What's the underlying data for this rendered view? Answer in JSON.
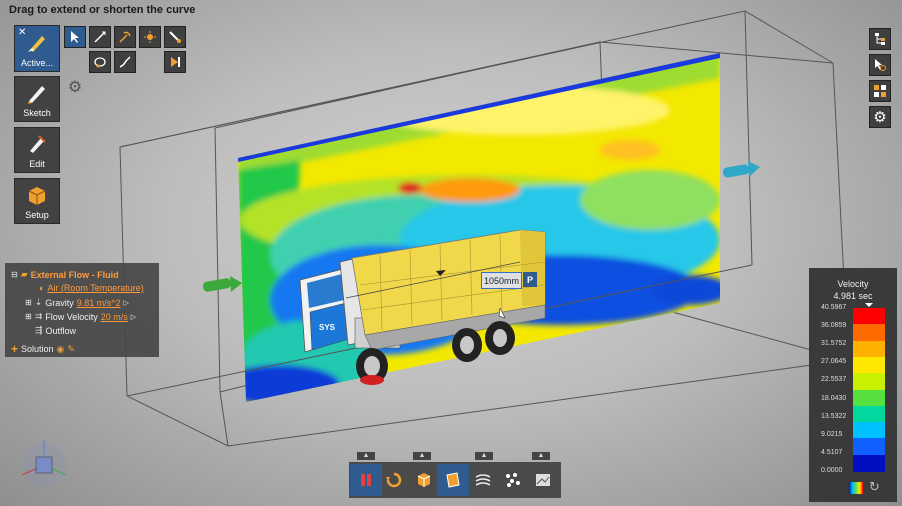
{
  "hint": "Drag to extend or shorten the curve",
  "toolbar": {
    "active_label": "Active...",
    "sketch_label": "Sketch",
    "edit_label": "Edit",
    "setup_label": "Setup"
  },
  "tree": {
    "root": "External Flow - Fluid",
    "fluid": "Air (Room Temperature)",
    "gravity_label": "Gravity",
    "gravity_value": "9.81 m/s^2",
    "flow_velocity_label": "Flow Velocity",
    "flow_velocity_value": "20 m/s",
    "outflow": "Outflow",
    "solution": "Solution"
  },
  "dimension": {
    "value": "1050mm",
    "tag": "P"
  },
  "truck_logo": "SYS",
  "legend": {
    "title": "Velocity",
    "time": "4.981 sec",
    "values": [
      "40.5967",
      "36.0859",
      "31.5752",
      "27.0645",
      "22.5537",
      "18.0430",
      "13.5322",
      "9.0215",
      "4.5107",
      "0.0000"
    ],
    "colors": [
      "#ff0000",
      "#ff6a00",
      "#ffb000",
      "#ffe800",
      "#c8f000",
      "#55e040",
      "#00d8a0",
      "#00c0ff",
      "#1060ff",
      "#0010c0"
    ]
  },
  "accent": "#2f5b8f",
  "icons": [
    "select-icon",
    "curve-icon",
    "pick-icon",
    "light-icon",
    "brush-icon",
    "lasso-icon",
    "stroke-icon",
    "play-icon",
    "gear-icon",
    "pause-icon",
    "reset-icon",
    "box-icon",
    "plane-icon",
    "flowlines-icon",
    "particles-icon",
    "image-icon",
    "tree-icon",
    "select-pick-icon",
    "grid-icon",
    "settings-icon",
    "legend-icon",
    "rotate-icon"
  ]
}
